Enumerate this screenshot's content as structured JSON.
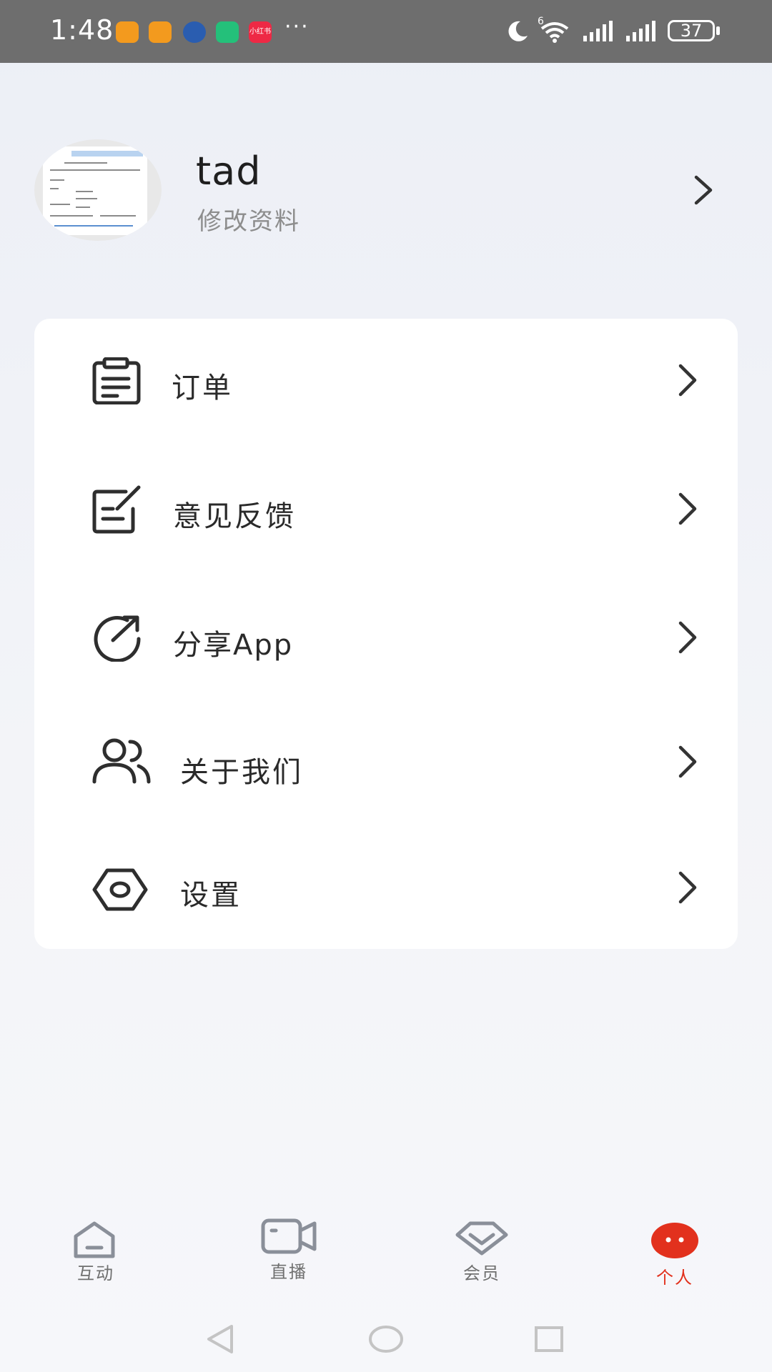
{
  "status_bar": {
    "time": "1:48",
    "more_indicator": "···",
    "battery_level": "37",
    "signal_badge": "6",
    "app_icons": [
      {
        "name": "orange-app-icon-1",
        "color": "#f39a1e"
      },
      {
        "name": "orange-app-icon-2",
        "color": "#f39a1e"
      },
      {
        "name": "blue-app-icon",
        "color": "#2a5db0"
      },
      {
        "name": "green-app-icon",
        "color": "#24c07a"
      },
      {
        "name": "xiaohongshu-icon",
        "color": "#ee2945",
        "text": "小红书"
      }
    ]
  },
  "profile": {
    "username": "tad",
    "edit_label": "修改资料"
  },
  "menu": {
    "items": [
      {
        "label": "订单",
        "icon": "clipboard-icon"
      },
      {
        "label": "意见反馈",
        "icon": "feedback-edit-icon"
      },
      {
        "label": "分享App",
        "icon": "share-refresh-icon"
      },
      {
        "label": "关于我们",
        "icon": "users-icon"
      },
      {
        "label": "设置",
        "icon": "hexagon-settings-icon"
      }
    ]
  },
  "bottom_nav": {
    "items": [
      {
        "label": "互动",
        "icon": "home-icon",
        "active": false
      },
      {
        "label": "直播",
        "icon": "video-camera-icon",
        "active": false
      },
      {
        "label": "会员",
        "icon": "diamond-icon",
        "active": false
      },
      {
        "label": "个人",
        "icon": "face-icon",
        "active": true
      }
    ]
  },
  "colors": {
    "accent": "#e2311d",
    "text_primary": "#2a2a2a",
    "text_secondary": "#8d8d8d",
    "nav_inactive": "#8a8f99"
  }
}
